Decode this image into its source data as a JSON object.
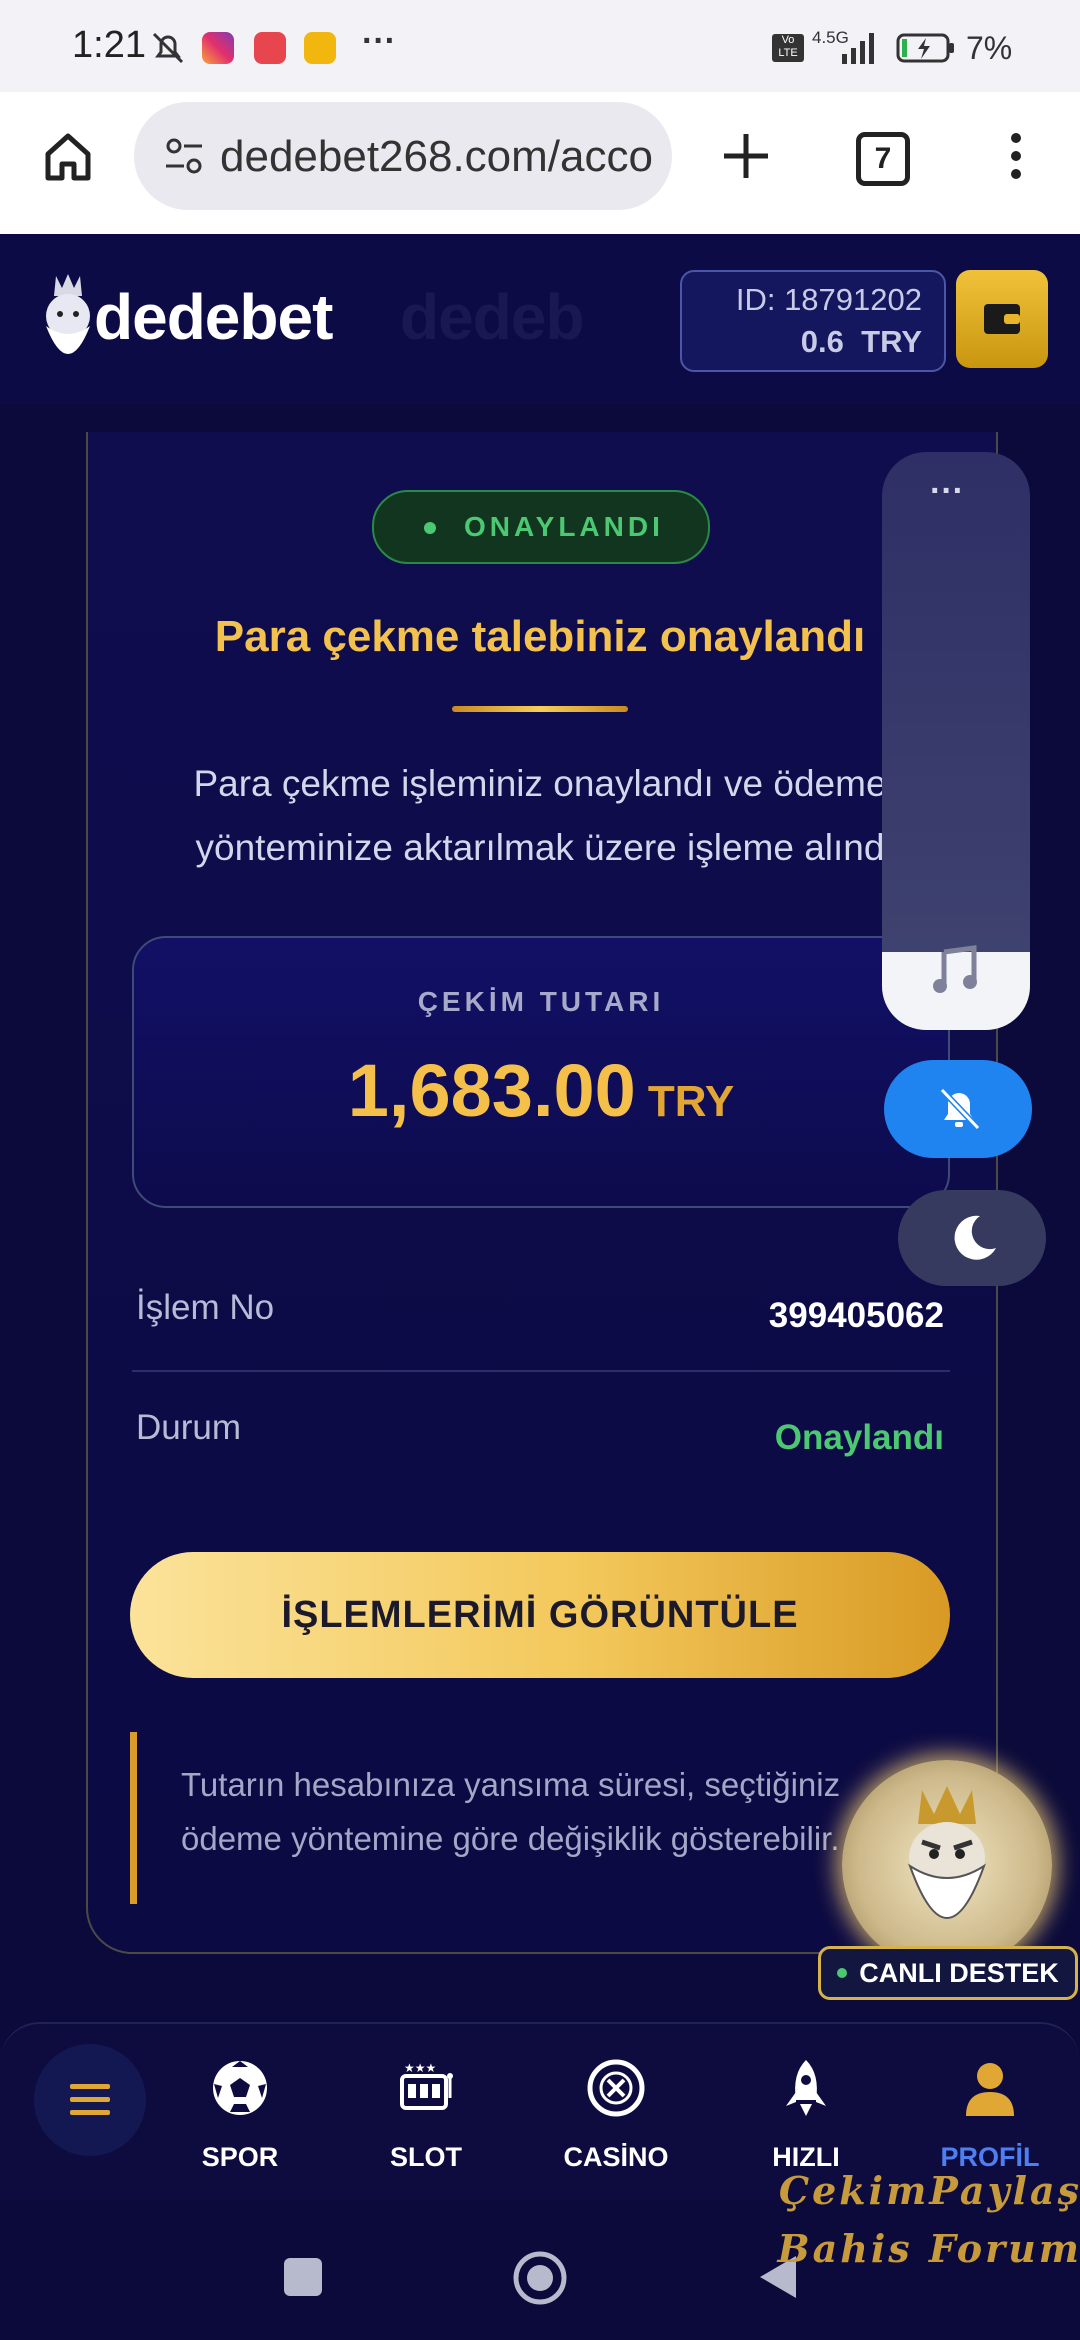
{
  "status_bar": {
    "time": "1:21",
    "network": "4.5G",
    "volte": "Vo LTE",
    "battery": "7%"
  },
  "browser": {
    "url": "dedebet268.com/acco",
    "tab_count": "7"
  },
  "header": {
    "logo": "dedebet",
    "account_id": "ID: 18791202",
    "balance": "0.6",
    "currency": "TRY"
  },
  "withdrawal": {
    "badge": "ONAYLANDI",
    "title": "Para çekme talebiniz onaylandı",
    "description_line1": "Para çekme işleminiz onaylandı ve ödeme",
    "description_line2": "yönteminize aktarılmak üzere işleme alınd",
    "amount_label": "ÇEKİM TUTARI",
    "amount_value": "1,683.00",
    "amount_currency": "TRY",
    "rows": [
      {
        "label": "İşlem No",
        "value": "399405062"
      },
      {
        "label": "Durum",
        "value": "Onaylandı"
      }
    ],
    "button": "İŞLEMLERİMİ GÖRÜNTÜLE",
    "note_line1": "Tutarın hesabınıza yansıma süresi, seçtiğiniz",
    "note_line2": "ödeme yöntemine göre değişiklik gösterebilir."
  },
  "support": {
    "label": "CANLI DESTEK"
  },
  "bottom_nav": [
    {
      "label": "SPOR",
      "icon": "soccer-ball-icon"
    },
    {
      "label": "SLOT",
      "icon": "slot-machine-icon"
    },
    {
      "label": "CASİNO",
      "icon": "casino-chip-icon"
    },
    {
      "label": "HIZLI",
      "icon": "rocket-icon"
    },
    {
      "label": "PROFİL",
      "icon": "profile-icon"
    }
  ],
  "watermark": {
    "line1": "ÇekimPaylaş",
    "line2": "Bahis Forum"
  },
  "colors": {
    "accent": "#f2c14e",
    "approved": "#4cc872",
    "active_nav": "#4e7ff2",
    "bell": "#1f84f0"
  }
}
